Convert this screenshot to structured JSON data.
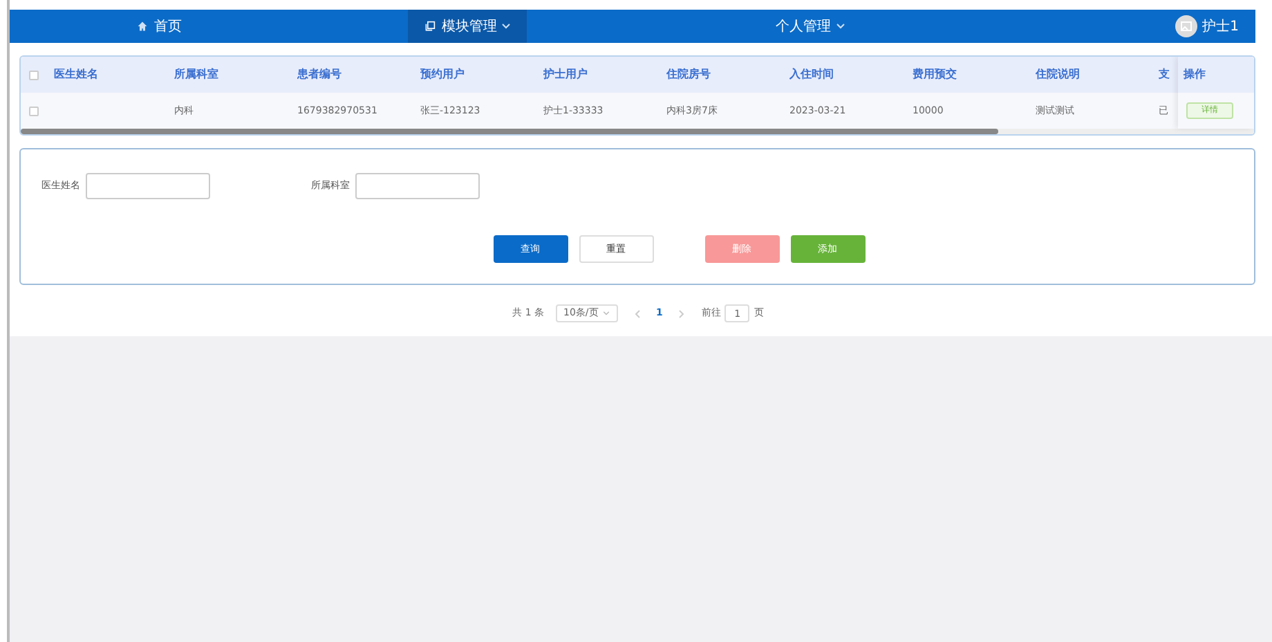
{
  "nav": [
    {
      "label": "首页",
      "selected": false,
      "dropdown": false
    },
    {
      "label": "模块管理",
      "selected": true,
      "dropdown": true
    },
    {
      "label": "个人管理",
      "selected": false,
      "dropdown": true
    },
    {
      "label": "护士1",
      "selected": false,
      "dropdown": false
    }
  ],
  "table": {
    "all_checked": false,
    "columns": [
      "医生姓名",
      "所属科室",
      "患者编号",
      "预约用户",
      "护士用户",
      "住院房号",
      "入住时间",
      "费用预交",
      "住院说明",
      "支"
    ],
    "action_column": "操作",
    "rows": [
      {
        "checked": false,
        "cells": [
          "",
          "内科",
          "1679382970531",
          "张三-123123",
          "护士1-33333",
          "内科3房7床",
          "2023-03-21",
          "10000",
          "测试测试",
          "已"
        ],
        "action": "详情"
      }
    ]
  },
  "search": {
    "fields": [
      {
        "label": "医生姓名"
      },
      {
        "label": "所属科室"
      }
    ],
    "buttons": [
      {
        "label": "查询",
        "kind": "primary"
      },
      {
        "label": "重置",
        "kind": "default"
      },
      {
        "label": "删除",
        "kind": "danger"
      },
      {
        "label": "添加",
        "kind": "success"
      }
    ]
  },
  "pagination": {
    "total": "共 1 条",
    "page_size": "10条/页",
    "pages": [
      {
        "label": "1",
        "selected": true
      }
    ],
    "goto_label": "前往",
    "goto_value": "1",
    "goto_suffix": "页"
  }
}
